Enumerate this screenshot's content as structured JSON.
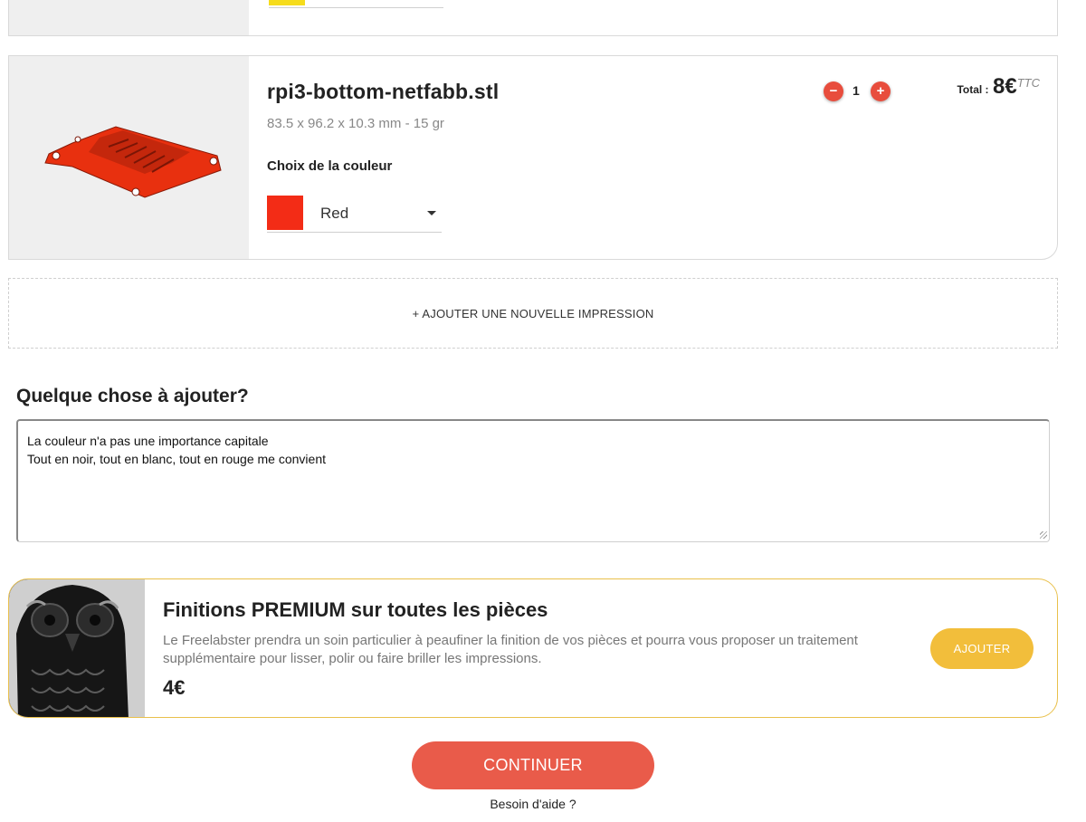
{
  "prev_item": {
    "color_hex": "#f6dc1c"
  },
  "item": {
    "file_name": "rpi3-bottom-netfabb.stl",
    "dimensions": "83.5 x 96.2 x 10.3 mm - 15 gr",
    "color_section_title": "Choix de la couleur",
    "color_selected": "Red",
    "color_hex": "#f32c16",
    "quantity": "1",
    "minus_icon": "minus-icon",
    "plus_icon": "plus-icon",
    "total_label": "Total :",
    "total_value": "8€",
    "total_suffix": "TTC"
  },
  "add_print_label": "+ AJOUTER UNE NOUVELLE IMPRESSION",
  "notes": {
    "title": "Quelque chose à ajouter?",
    "value": "La couleur n'a pas une importance capitale\nTout en noir, tout en blanc, tout en rouge me convient"
  },
  "premium": {
    "title": "Finitions PREMIUM sur toutes les pièces",
    "description": "Le Freelabster prendra un soin particulier à peaufiner la finition de vos pièces et pourra vous proposer un traitement supplémentaire pour lisser, polir ou faire briller les impressions.",
    "price": "4€",
    "button_label": "AJOUTER",
    "accent_hex": "#f2be3b"
  },
  "continue_label": "CONTINUER",
  "help_label": "Besoin d'aide ?",
  "brand_red_hex": "#e95b4a"
}
